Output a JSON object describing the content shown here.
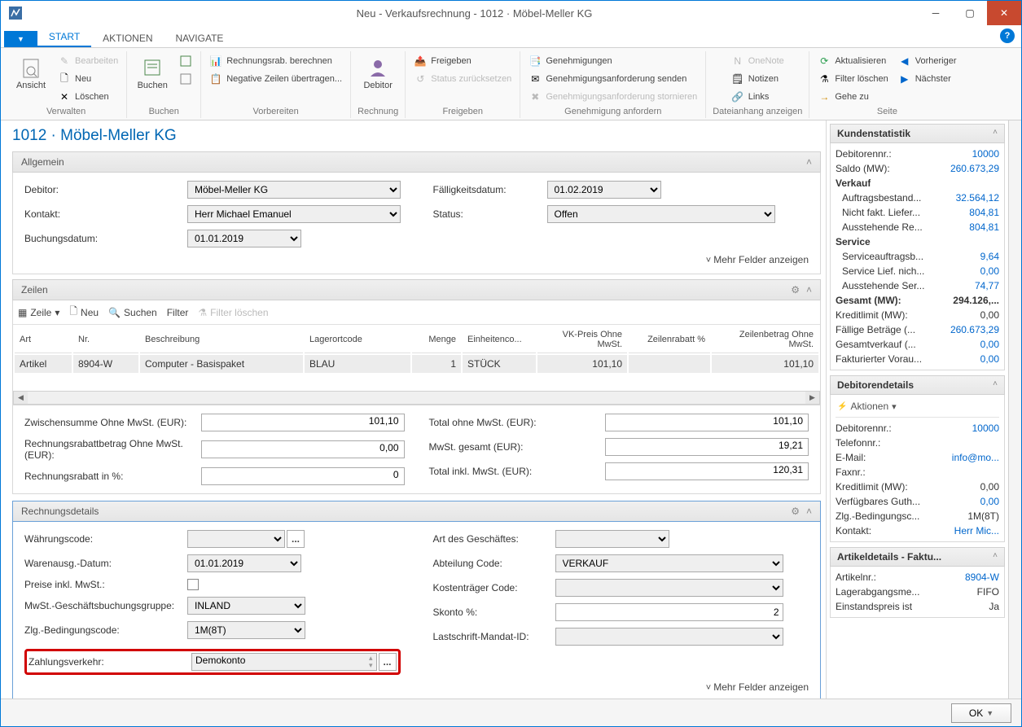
{
  "window": {
    "title": "Neu - Verkaufsrechnung - 1012 · Möbel-Meller KG"
  },
  "menu": {
    "file": "▾",
    "tabs": [
      "START",
      "AKTIONEN",
      "NAVIGATE"
    ]
  },
  "ribbon": {
    "groups": {
      "verwalten": {
        "label": "Verwalten",
        "ansicht": "Ansicht",
        "bearbeiten": "Bearbeiten",
        "neu": "Neu",
        "loeschen": "Löschen"
      },
      "buchen": {
        "label": "Buchen",
        "buchen": "Buchen"
      },
      "vorbereiten": {
        "label": "Vorbereiten",
        "rr": "Rechnungsrab. berechnen",
        "nz": "Negative Zeilen übertragen..."
      },
      "rechnung": {
        "label": "Rechnung",
        "debitor": "Debitor"
      },
      "freigeben": {
        "label": "Freigeben",
        "fg": "Freigeben",
        "sz": "Status zurücksetzen"
      },
      "genehmigung": {
        "label": "Genehmigung anfordern",
        "g": "Genehmigungen",
        "gs": "Genehmigungsanforderung senden",
        "gst": "Genehmigungsanforderung stornieren"
      },
      "datei": {
        "label": "Dateianhang anzeigen",
        "on": "OneNote",
        "no": "Notizen",
        "li": "Links"
      },
      "seite": {
        "label": "Seite",
        "akt": "Aktualisieren",
        "fl": "Filter löschen",
        "gz": "Gehe zu",
        "vor": "Vorheriger",
        "nae": "Nächster"
      }
    }
  },
  "page": {
    "title": "1012 · Möbel-Meller KG"
  },
  "allgemein": {
    "title": "Allgemein",
    "debitor_label": "Debitor:",
    "debitor": "Möbel-Meller KG",
    "kontakt_label": "Kontakt:",
    "kontakt": "Herr Michael Emanuel",
    "buchungsdatum_label": "Buchungsdatum:",
    "buchungsdatum": "01.01.2019",
    "faelligkeitsdatum_label": "Fälligkeitsdatum:",
    "faelligkeitsdatum": "01.02.2019",
    "status_label": "Status:",
    "status": "Offen",
    "more": "Mehr Felder anzeigen"
  },
  "zeilen": {
    "title": "Zeilen",
    "toolbar": {
      "zeile": "Zeile",
      "neu": "Neu",
      "suchen": "Suchen",
      "filter": "Filter",
      "filter_loeschen": "Filter löschen"
    },
    "cols": {
      "art": "Art",
      "nr": "Nr.",
      "beschr": "Beschreibung",
      "lager": "Lagerortcode",
      "menge": "Menge",
      "einheit": "Einheitenco...",
      "vk": "VK-Preis Ohne MwSt.",
      "rab": "Zeilenrabatt %",
      "betrag": "Zeilenbetrag Ohne MwSt."
    },
    "row": {
      "art": "Artikel",
      "nr": "8904-W",
      "beschr": "Computer - Basispaket",
      "lager": "BLAU",
      "menge": "1",
      "einheit": "STÜCK",
      "vk": "101,10",
      "rab": "",
      "betrag": "101,10"
    }
  },
  "totals": {
    "zw_l": "Zwischensumme Ohne MwSt. (EUR):",
    "zw_v": "101,10",
    "rrb_l": "Rechnungsrabattbetrag Ohne MwSt. (EUR):",
    "rrb_v": "0,00",
    "rrp_l": "Rechnungsrabatt in %:",
    "rrp_v": "0",
    "to_l": "Total ohne MwSt. (EUR):",
    "to_v": "101,10",
    "mg_l": "MwSt. gesamt (EUR):",
    "mg_v": "19,21",
    "ti_l": "Total inkl. MwSt. (EUR):",
    "ti_v": "120,31"
  },
  "rdetails": {
    "title": "Rechnungsdetails",
    "waehrung_l": "Währungscode:",
    "waehrung_v": "",
    "warenausg_l": "Warenausg.-Datum:",
    "warenausg_v": "01.01.2019",
    "preiseinkl_l": "Preise inkl. MwSt.:",
    "mwstgr_l": "MwSt.-Geschäftsbuchungsgruppe:",
    "mwstgr_v": "INLAND",
    "zlgbed_l": "Zlg.-Bedingungscode:",
    "zlgbed_v": "1M(8T)",
    "zahlv_l": "Zahlungsverkehr:",
    "zahlv_v": "Demokonto",
    "artg_l": "Art des Geschäftes:",
    "artg_v": "",
    "abt_l": "Abteilung Code:",
    "abt_v": "VERKAUF",
    "kost_l": "Kostenträger Code:",
    "kost_v": "",
    "skonto_l": "Skonto %:",
    "skonto_v": "2",
    "last_l": "Lastschrift-Mandat-ID:",
    "last_v": "",
    "more": "Mehr Felder anzeigen"
  },
  "kundenstatistik": {
    "title": "Kundenstatistik",
    "rows": [
      {
        "k": "Debitorennr.:",
        "v": "10000",
        "link": true
      },
      {
        "k": "Saldo (MW):",
        "v": "260.673,29",
        "link": true
      }
    ],
    "verkauf_h": "Verkauf",
    "verkauf": [
      {
        "k": "Auftragsbestand...",
        "v": "32.564,12",
        "link": true
      },
      {
        "k": "Nicht fakt. Liefer...",
        "v": "804,81",
        "link": true
      },
      {
        "k": "Ausstehende Re...",
        "v": "804,81",
        "link": true
      }
    ],
    "service_h": "Service",
    "service": [
      {
        "k": "Serviceauftragsb...",
        "v": "9,64",
        "link": true
      },
      {
        "k": "Service Lief. nich...",
        "v": "0,00",
        "link": true
      },
      {
        "k": "Ausstehende Ser...",
        "v": "74,77",
        "link": true
      }
    ],
    "rest": [
      {
        "k": "Gesamt (MW):",
        "v": "294.126,...",
        "bold": true
      },
      {
        "k": "Kreditlimit (MW):",
        "v": "0,00"
      },
      {
        "k": "Fällige Beträge (...",
        "v": "260.673,29",
        "link": true
      },
      {
        "k": "Gesamtverkauf (...",
        "v": "0,00",
        "link": true
      },
      {
        "k": "Fakturierter Vorau...",
        "v": "0,00",
        "link": true
      }
    ]
  },
  "debitorendetails": {
    "title": "Debitorendetails",
    "action": "Aktionen",
    "rows": [
      {
        "k": "Debitorennr.:",
        "v": "10000",
        "link": true
      },
      {
        "k": "Telefonnr.:",
        "v": ""
      },
      {
        "k": "E-Mail:",
        "v": "info@mo...",
        "link": true
      },
      {
        "k": "Faxnr.:",
        "v": ""
      },
      {
        "k": "Kreditlimit (MW):",
        "v": "0,00"
      },
      {
        "k": "Verfügbares Guth...",
        "v": "0,00",
        "link": true
      },
      {
        "k": "Zlg.-Bedingungsc...",
        "v": "1M(8T)"
      },
      {
        "k": "Kontakt:",
        "v": "Herr Mic...",
        "link": true
      }
    ]
  },
  "artikeldetails": {
    "title": "Artikeldetails - Faktu...",
    "rows": [
      {
        "k": "Artikelnr.:",
        "v": "8904-W",
        "link": true
      },
      {
        "k": "Lagerabgangsme...",
        "v": "FIFO"
      },
      {
        "k": "Einstandspreis ist",
        "v": "Ja"
      }
    ]
  },
  "footer": {
    "ok": "OK"
  }
}
